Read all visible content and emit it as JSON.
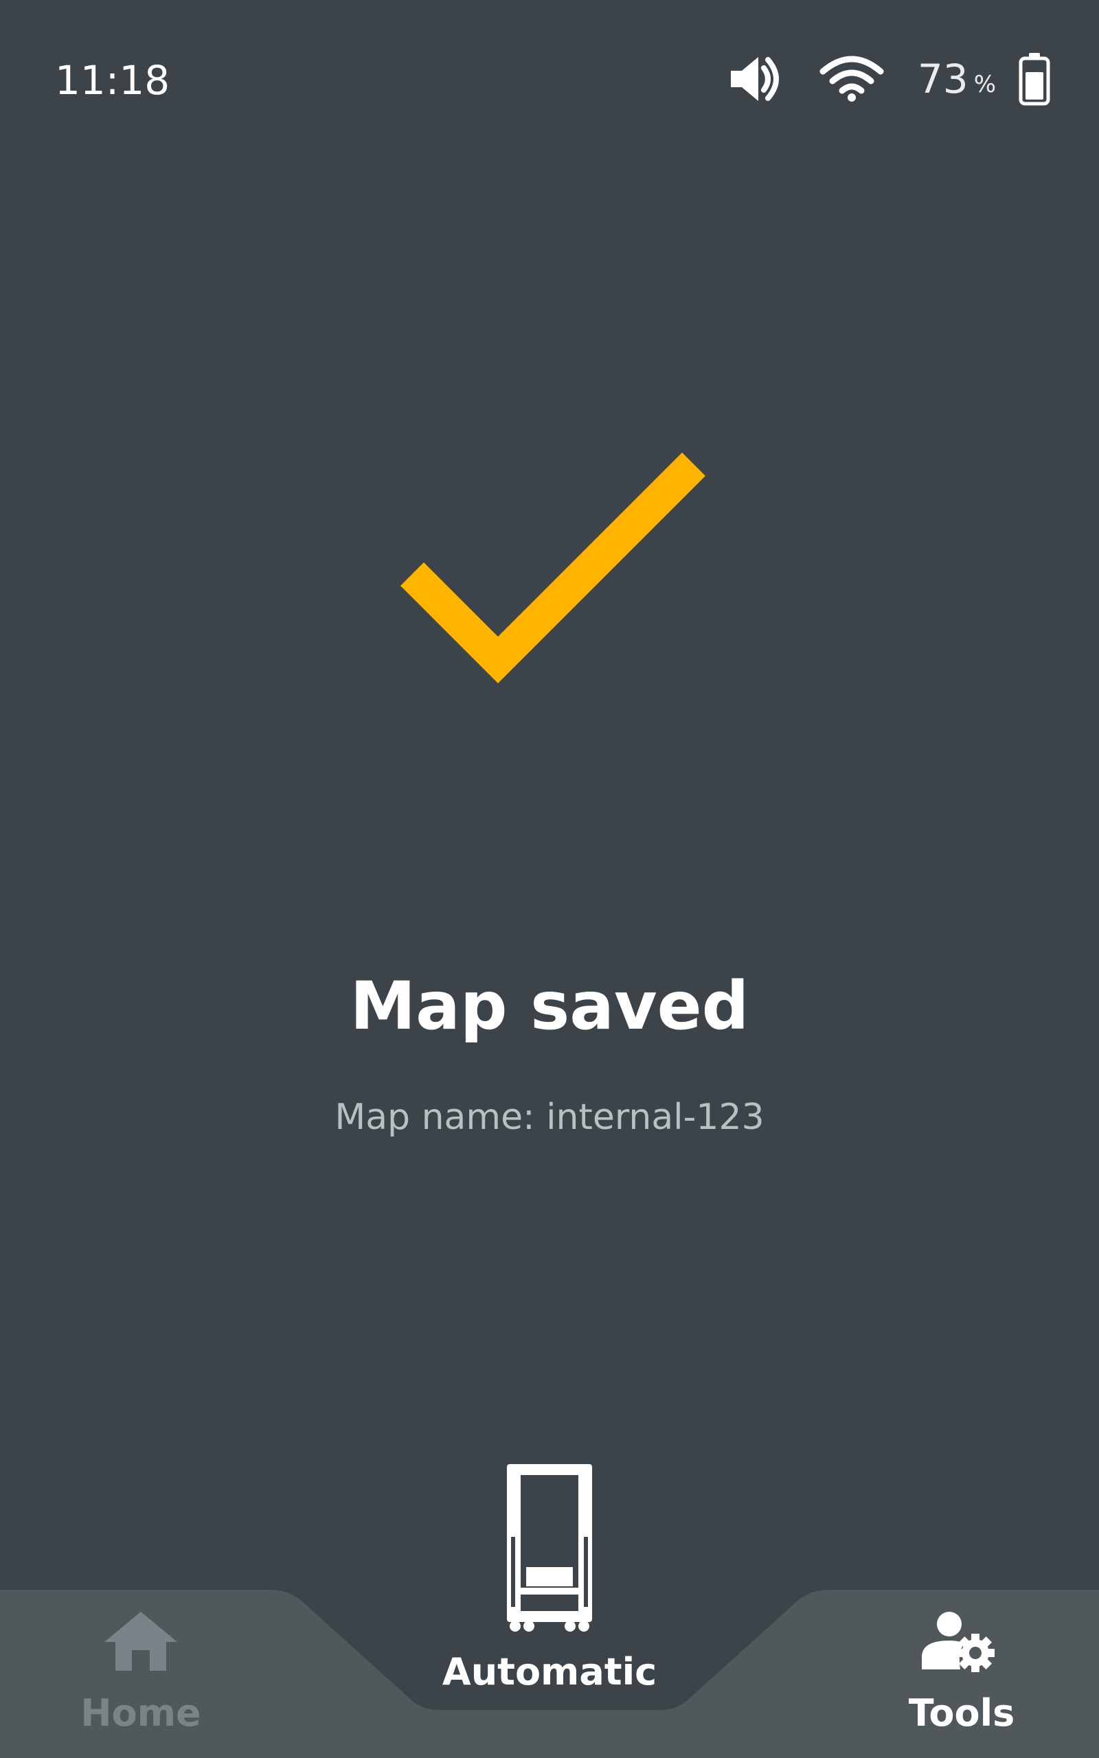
{
  "status_bar": {
    "time": "11:18",
    "battery_level": "73",
    "battery_unit": "%",
    "icons": [
      "volume-icon",
      "wifi-icon",
      "battery-icon"
    ]
  },
  "result": {
    "icon": "checkmark-icon",
    "title": "Map saved",
    "subtitle": "Map name: internal-123"
  },
  "nav": {
    "items": [
      {
        "label": "Home",
        "icon": "home-icon",
        "state": "inactive"
      },
      {
        "label": "Automatic",
        "icon": "robot-cart-icon",
        "state": "active"
      },
      {
        "label": "Tools",
        "icon": "user-gear-icon",
        "state": "active"
      }
    ]
  },
  "colors": {
    "background": "#3d4449",
    "nav_tab": "#50585b",
    "accent": "#ffb400",
    "inactive": "#7b8388",
    "text": "#ffffff",
    "subtext": "#b9c0c4"
  }
}
